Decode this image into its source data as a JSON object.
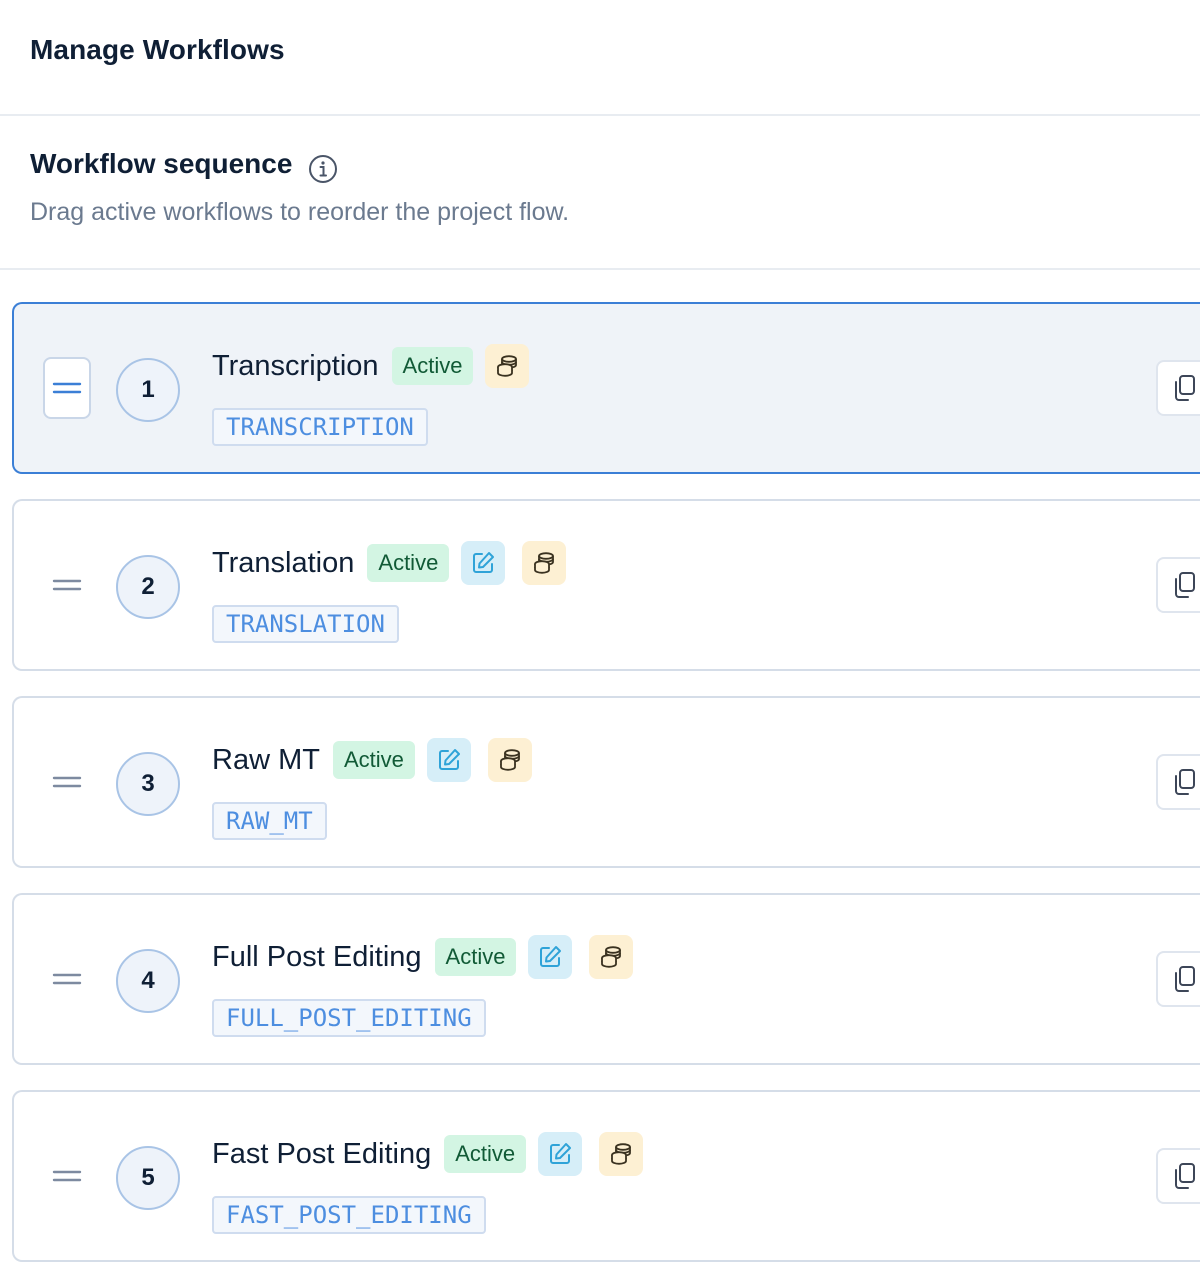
{
  "header": {
    "title": "Manage Workflows"
  },
  "sequence": {
    "title": "Workflow sequence",
    "subtitle": "Drag active workflows to reorder the project flow."
  },
  "workflows": [
    {
      "order": "1",
      "name": "Transcription",
      "status": "Active",
      "code": "TRANSCRIPTION",
      "editable": false,
      "selected": true
    },
    {
      "order": "2",
      "name": "Translation",
      "status": "Active",
      "code": "TRANSLATION",
      "editable": true,
      "selected": false
    },
    {
      "order": "3",
      "name": "Raw MT",
      "status": "Active",
      "code": "RAW_MT",
      "editable": true,
      "selected": false
    },
    {
      "order": "4",
      "name": "Full Post Editing",
      "status": "Active",
      "code": "FULL_POST_EDITING",
      "editable": true,
      "selected": false
    },
    {
      "order": "5",
      "name": "Fast Post Editing",
      "status": "Active",
      "code": "FAST_POST_EDITING",
      "editable": true,
      "selected": false
    }
  ],
  "icons": {
    "info": "info-icon",
    "drag": "drag-handle-icon",
    "edit": "edit-icon",
    "database": "database-icon",
    "copy": "copy-icon"
  },
  "colors": {
    "accent": "#3b7fd6",
    "active_badge_bg": "#d3f5e3",
    "active_badge_text": "#115a36",
    "code_text": "#4d8ee0"
  }
}
